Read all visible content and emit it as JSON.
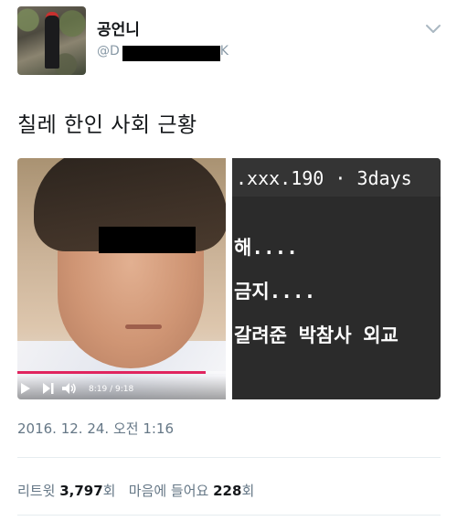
{
  "profile": {
    "display_name": "공언니",
    "handle_visible": "@D",
    "handle_tail": "K",
    "avatar_icon": "avatar-photo"
  },
  "tweet": {
    "text": "칠레 한인 사회 근황",
    "timestamp": "2016. 12. 24. 오전 1:16"
  },
  "video": {
    "timecode": "8:19 / 9:18",
    "progress": 0.905,
    "progress_color": "#e0245e"
  },
  "screenshot_image": {
    "lines": [
      ".xxx.190 · 3days",
      "해....",
      "금지....",
      "갈려준 박참사 외교"
    ]
  },
  "stats": {
    "retweet_label": "리트윗",
    "retweet_count": "3,797",
    "retweet_unit": "회",
    "likes_label": "마음에 들어요",
    "likes_count": "228",
    "likes_unit": "회"
  },
  "colors": {
    "text_primary": "#14171a",
    "text_secondary": "#657786",
    "divider": "#e6ecf0"
  }
}
